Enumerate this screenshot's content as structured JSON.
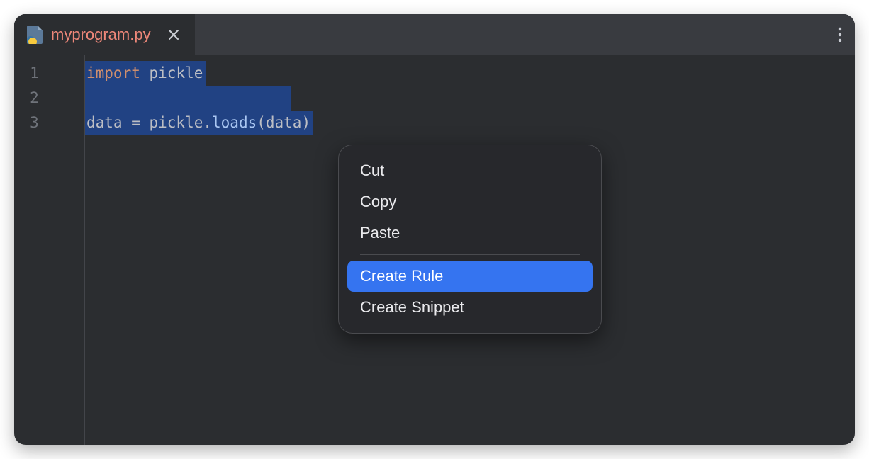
{
  "tab": {
    "filename": "myprogram.py"
  },
  "editor": {
    "lines": [
      "1",
      "2",
      "3"
    ],
    "code": {
      "line1": {
        "keyword": "import",
        "space": " ",
        "module": "pickle"
      },
      "line3": {
        "part1": "data = pickle.",
        "func": "loads",
        "part2": "(data)"
      }
    }
  },
  "contextMenu": {
    "cut": "Cut",
    "copy": "Copy",
    "paste": "Paste",
    "createRule": "Create Rule",
    "createSnippet": "Create Snippet"
  }
}
